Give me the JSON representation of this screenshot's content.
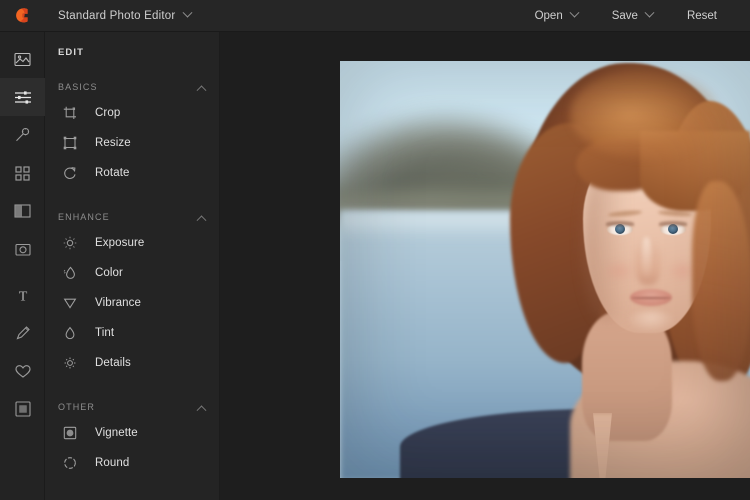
{
  "topbar": {
    "logo_icon": "app-logo-icon",
    "app_title": "Standard Photo Editor",
    "app_title_chevron": "chevron-down-icon",
    "actions": [
      {
        "label": "Open",
        "chevron": "chevron-down-icon",
        "has_chevron": true
      },
      {
        "label": "Save",
        "chevron": "chevron-down-icon",
        "has_chevron": true
      },
      {
        "label": "Reset",
        "chevron": "",
        "has_chevron": false
      }
    ]
  },
  "rail": {
    "items": [
      {
        "name": "image-icon",
        "active": false
      },
      {
        "name": "sliders-icon",
        "active": true
      },
      {
        "name": "magic-wand-icon",
        "active": false
      },
      {
        "name": "grid-icon",
        "active": false
      },
      {
        "name": "compare-split-icon",
        "active": false
      },
      {
        "name": "camera-icon",
        "active": false
      },
      {
        "name": "text-icon",
        "active": false
      },
      {
        "name": "brush-icon",
        "active": false
      },
      {
        "name": "heart-icon",
        "active": false
      },
      {
        "name": "frame-icon",
        "active": false
      }
    ]
  },
  "panel": {
    "title": "EDIT",
    "sections": [
      {
        "label": "BASICS",
        "collapse_icon": "chevron-up-icon",
        "items": [
          {
            "label": "Crop",
            "icon": "crop-icon"
          },
          {
            "label": "Resize",
            "icon": "resize-icon"
          },
          {
            "label": "Rotate",
            "icon": "rotate-icon"
          }
        ]
      },
      {
        "label": "ENHANCE",
        "collapse_icon": "chevron-up-icon",
        "items": [
          {
            "label": "Exposure",
            "icon": "sun-icon"
          },
          {
            "label": "Color",
            "icon": "color-droplet-icon"
          },
          {
            "label": "Vibrance",
            "icon": "vibrance-triangle-icon"
          },
          {
            "label": "Tint",
            "icon": "tint-droplet-icon"
          },
          {
            "label": "Details",
            "icon": "details-sparkle-icon"
          }
        ]
      },
      {
        "label": "OTHER",
        "collapse_icon": "chevron-up-icon",
        "items": [
          {
            "label": "Vignette",
            "icon": "vignette-icon"
          },
          {
            "label": "Round",
            "icon": "round-corners-icon"
          }
        ]
      }
    ]
  },
  "canvas": {
    "photo_alt": "portrait of red-haired woman in dark blue shirt in front of blurred lake and mountain"
  },
  "colors": {
    "topbar_bg": "#262626",
    "rail_bg": "#232323",
    "rail_active_bg": "#2d2d2d",
    "panel_bg": "#242424",
    "canvas_bg": "#1e1e1e",
    "text_primary": "#e0e0e0",
    "text_secondary": "#8d8d8d",
    "logo_accent": "#f26522"
  }
}
